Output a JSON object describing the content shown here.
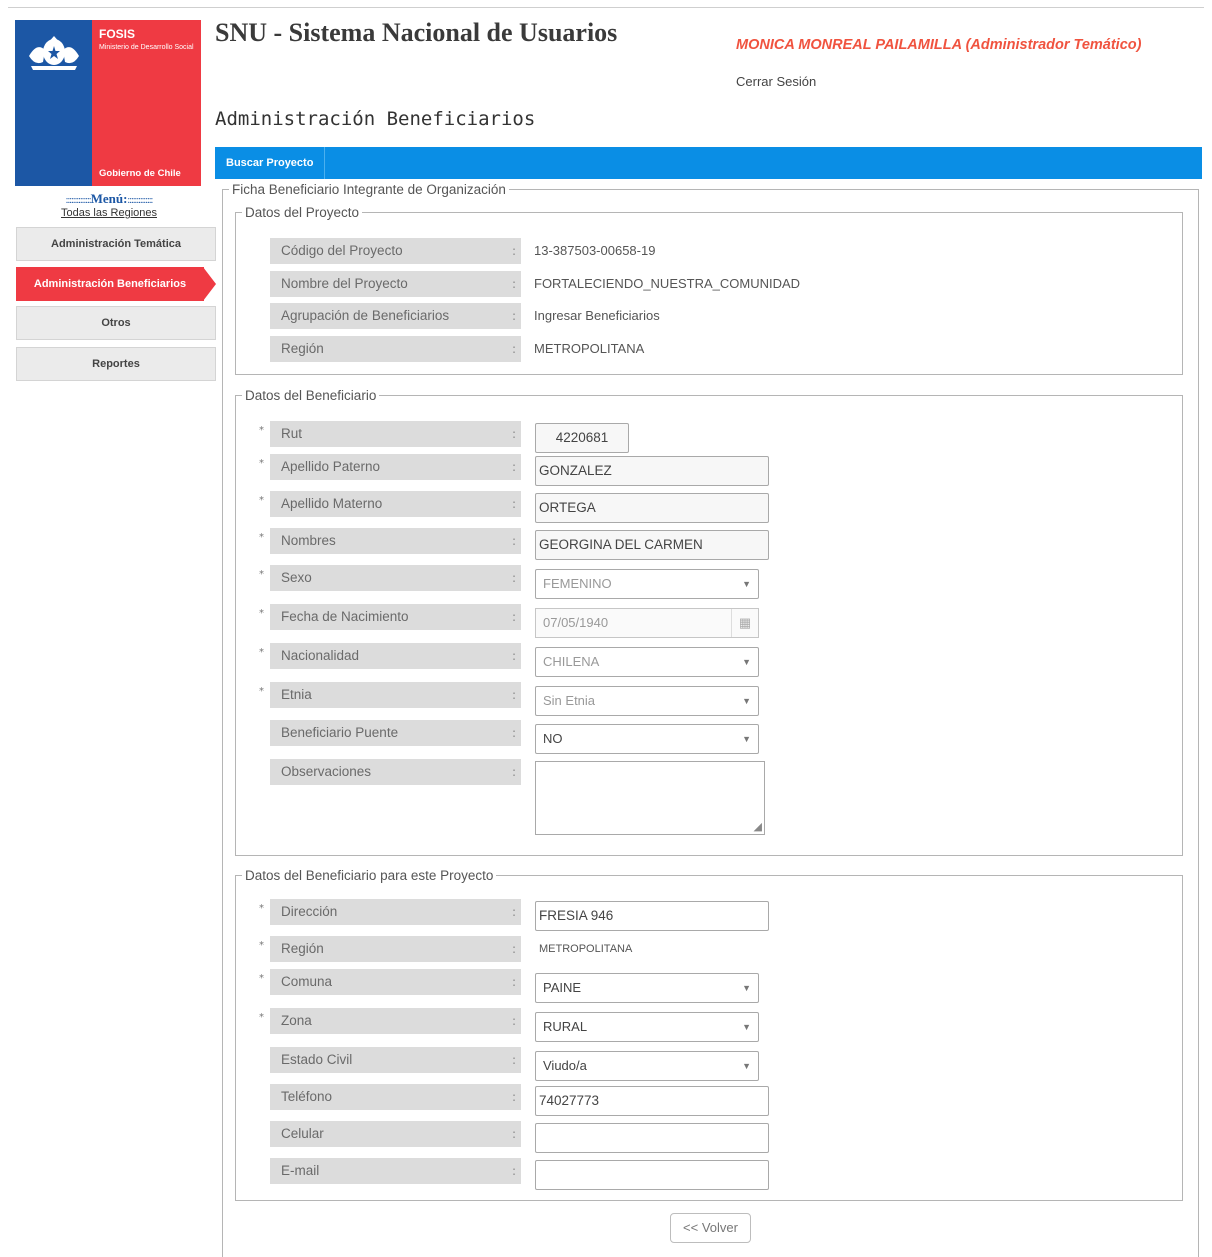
{
  "sidebar": {
    "logo": {
      "brand": "FOSIS",
      "ministry": "Ministerio de Desarrollo Social",
      "government": "Gobierno de Chile"
    },
    "menu_title": "Menú",
    "regions_link": "Todas las Regiones",
    "items": [
      {
        "label": "Administración Temática",
        "active": false
      },
      {
        "label": "Administración Beneficiarios",
        "active": true
      },
      {
        "label": "Otros",
        "active": false
      },
      {
        "label": "Reportes",
        "active": false
      }
    ]
  },
  "header": {
    "app_title": "SNU - Sistema Nacional de Usuarios",
    "user": "MONICA MONREAL PAILAMILLA (Administrador Temático)",
    "logout": "Cerrar Sesión",
    "page_title": "Administración Beneficiarios",
    "tab": "Buscar Proyecto"
  },
  "form": {
    "legend": "Ficha Beneficiario Integrante de Organización",
    "proyecto": {
      "legend": "Datos del Proyecto",
      "codigo_label": "Código del Proyecto",
      "codigo": "13-387503-00658-19",
      "nombre_label": "Nombre del Proyecto",
      "nombre": "FORTALECIENDO_NUESTRA_COMUNIDAD",
      "agrupacion_label": "Agrupación de Beneficiarios",
      "agrupacion": "Ingresar Beneficiarios",
      "region_label": "Región",
      "region": "METROPOLITANA"
    },
    "beneficiario": {
      "legend": "Datos del Beneficiario",
      "rut_label": "Rut",
      "rut": "4220681",
      "ap_paterno_label": "Apellido Paterno",
      "ap_paterno": "GONZALEZ",
      "ap_materno_label": "Apellido Materno",
      "ap_materno": "ORTEGA",
      "nombres_label": "Nombres",
      "nombres": "GEORGINA DEL CARMEN",
      "sexo_label": "Sexo",
      "sexo": "FEMENINO",
      "fecha_label": "Fecha de Nacimiento",
      "fecha": "07/05/1940",
      "nacionalidad_label": "Nacionalidad",
      "nacionalidad": "CHILENA",
      "etnia_label": "Etnia",
      "etnia": "Sin Etnia",
      "puente_label": "Beneficiario Puente",
      "puente": "NO",
      "observaciones_label": "Observaciones",
      "observaciones": ""
    },
    "beneficiario_proyecto": {
      "legend": "Datos del Beneficiario para este Proyecto",
      "direccion_label": "Dirección",
      "direccion": "FRESIA 946",
      "region_label": "Región",
      "region": "METROPOLITANA",
      "comuna_label": "Comuna",
      "comuna": "PAINE",
      "zona_label": "Zona",
      "zona": "RURAL",
      "estado_civil_label": "Estado Civil",
      "estado_civil": "Viudo/a",
      "telefono_label": "Teléfono",
      "telefono": "74027773",
      "celular_label": "Celular",
      "celular": "",
      "email_label": "E-mail",
      "email": ""
    },
    "back_button": "<< Volver"
  },
  "colors": {
    "accent_blue": "#0a8ee5",
    "brand_red": "#ef3a43",
    "brand_blue": "#1c57a5",
    "user_name": "#f0533f"
  }
}
